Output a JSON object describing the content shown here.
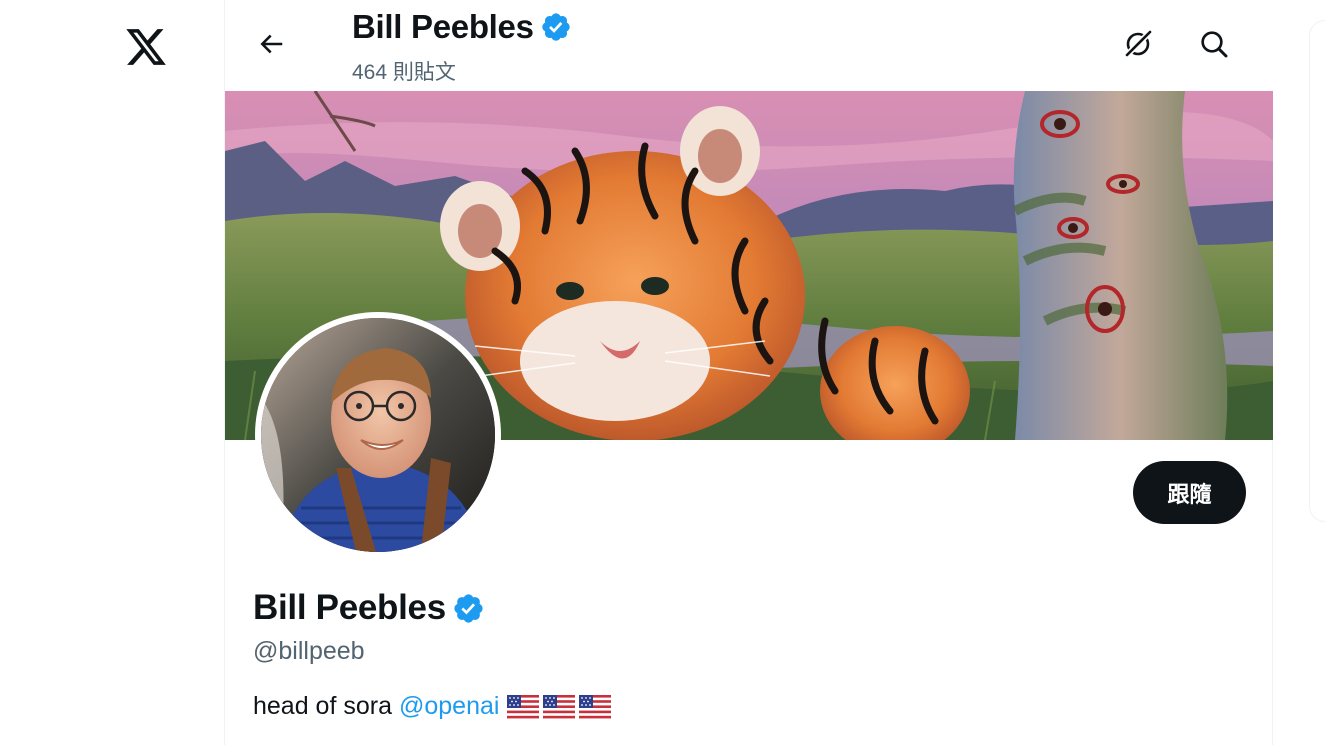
{
  "nav": {
    "logo_icon": "x-logo-icon"
  },
  "header": {
    "name": "Bill Peebles",
    "post_count": "464 則貼文",
    "back_icon": "arrow-left-icon",
    "grok_icon": "grok-icon",
    "search_icon": "search-icon"
  },
  "profile": {
    "display_name": "Bill Peebles",
    "handle": "@billpeeb",
    "bio_text": "head of sora",
    "bio_mention": "@openai",
    "follow_label": "跟隨",
    "verified_icon": "verified-badge-icon",
    "flags": [
      "us-flag-icon",
      "us-flag-icon",
      "us-flag-icon"
    ]
  },
  "colors": {
    "accent": "#1d9bf0",
    "text_primary": "#0f1419",
    "text_secondary": "#536471",
    "follow_bg": "#0f1419"
  }
}
